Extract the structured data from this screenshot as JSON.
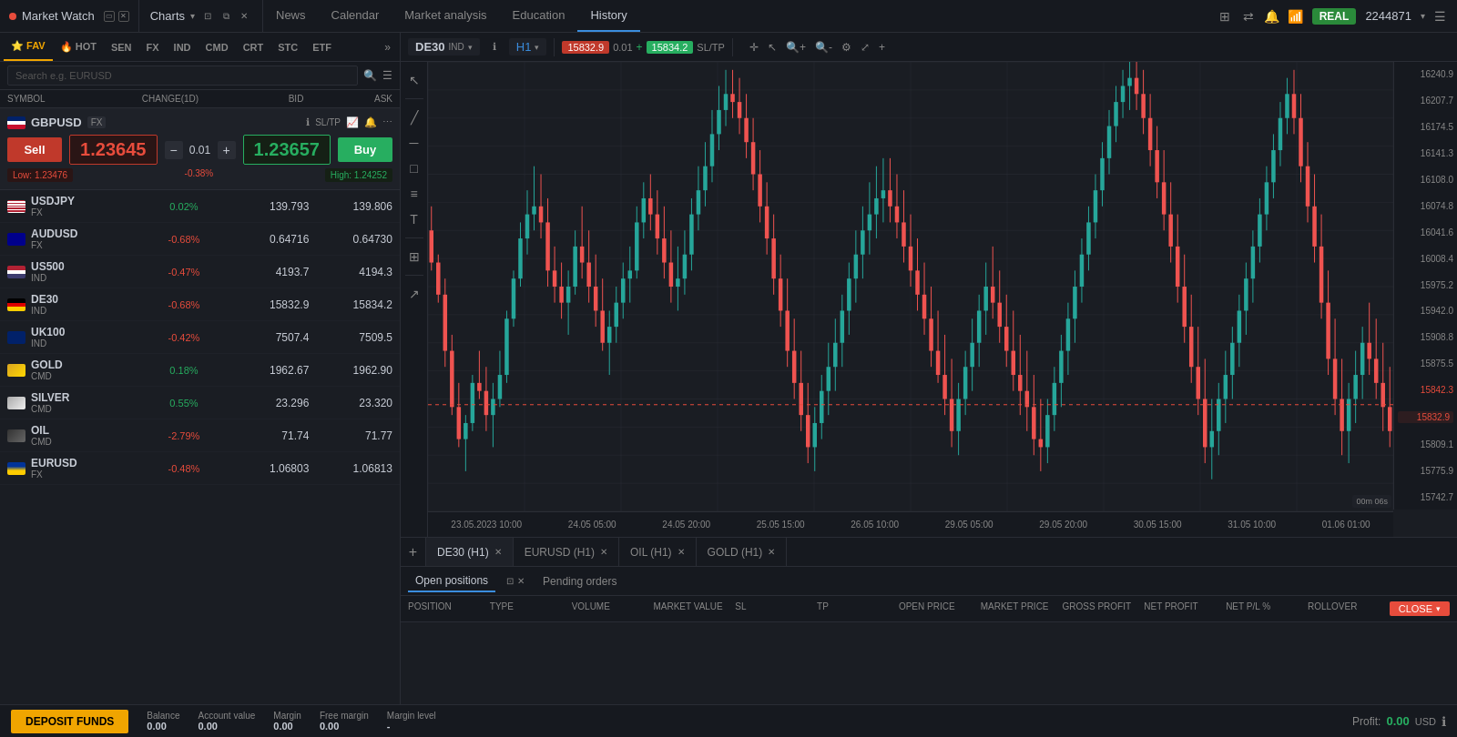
{
  "app": {
    "title": "Market Watch",
    "window_controls": [
      "minimize",
      "close"
    ]
  },
  "header": {
    "charts_label": "Charts",
    "nav_tabs": [
      {
        "label": "News",
        "active": false
      },
      {
        "label": "Calendar",
        "active": false
      },
      {
        "label": "Market analysis",
        "active": false
      },
      {
        "label": "Education",
        "active": false
      },
      {
        "label": "History",
        "active": true
      }
    ],
    "real_badge": "REAL",
    "account_number": "2244871"
  },
  "market_watch": {
    "search_placeholder": "Search e.g. EURUSD",
    "categories": [
      {
        "label": "FAV",
        "active": true
      },
      {
        "label": "HOT",
        "active": false
      },
      {
        "label": "SEN",
        "active": false
      },
      {
        "label": "FX",
        "active": false
      },
      {
        "label": "IND",
        "active": false
      },
      {
        "label": "CMD",
        "active": false
      },
      {
        "label": "CRT",
        "active": false
      },
      {
        "label": "STC",
        "active": false
      },
      {
        "label": "ETF",
        "active": false
      }
    ],
    "columns": [
      "SYMBOL",
      "CHANGE(1D)",
      "BID",
      "ASK"
    ],
    "featured": {
      "symbol": "GBPUSD",
      "type": "FX",
      "sell_label": "Sell",
      "buy_label": "Buy",
      "sell_price": "1.23645",
      "buy_price": "1.23657",
      "qty": "0.01",
      "change_pct": "-0.38%",
      "low": "Low: 1.23476",
      "high": "High: 1.24252",
      "sl_tp": "SL/TP"
    },
    "symbols": [
      {
        "symbol": "USDJPY",
        "type": "FX",
        "change": "0.02%",
        "change_pos": true,
        "bid": "139.793",
        "ask": "139.806",
        "flag": "flag-us"
      },
      {
        "symbol": "AUDUSD",
        "type": "FX",
        "change": "-0.68%",
        "change_pos": false,
        "bid": "0.64716",
        "ask": "0.64730",
        "flag": "flag-au"
      },
      {
        "symbol": "US500",
        "type": "IND",
        "change": "-0.47%",
        "change_pos": false,
        "bid": "4193.7",
        "ask": "4194.3",
        "flag": "flag-us2"
      },
      {
        "symbol": "DE30",
        "type": "IND",
        "change": "-0.68%",
        "change_pos": false,
        "bid": "15832.9",
        "ask": "15834.2",
        "flag": "flag-de"
      },
      {
        "symbol": "UK100",
        "type": "IND",
        "change": "-0.42%",
        "change_pos": false,
        "bid": "7507.4",
        "ask": "7509.5",
        "flag": "flag-uk"
      },
      {
        "symbol": "GOLD",
        "type": "CMD",
        "change": "0.18%",
        "change_pos": true,
        "bid": "1962.67",
        "ask": "1962.90",
        "flag": "flag-gold"
      },
      {
        "symbol": "SILVER",
        "type": "CMD",
        "change": "0.55%",
        "change_pos": true,
        "bid": "23.296",
        "ask": "23.320",
        "flag": "flag-silver"
      },
      {
        "symbol": "OIL",
        "type": "CMD",
        "change": "-2.79%",
        "change_pos": false,
        "bid": "71.74",
        "ask": "71.77",
        "flag": "flag-oil"
      },
      {
        "symbol": "EURUSD",
        "type": "FX",
        "change": "-0.48%",
        "change_pos": false,
        "bid": "1.06803",
        "ask": "1.06813",
        "flag": "flag-eu"
      }
    ]
  },
  "chart": {
    "symbol": "DE30",
    "type": "IND",
    "timeframe": "H1",
    "current_price_red": "15832.9",
    "spread": "0.01",
    "current_price_green": "15834.2",
    "sl_tp": "SL/TP",
    "price_labels": [
      "16240.9",
      "16207.7",
      "16174.5",
      "16141.3",
      "16108.0",
      "16074.8",
      "16041.6",
      "16008.4",
      "15975.2",
      "15942.0",
      "15908.8",
      "15875.5",
      "15842.3",
      "15832.9",
      "15809.1",
      "15775.9",
      "15742.7"
    ],
    "time_labels": [
      "23.05.2023 10:00",
      "24.05 05:00",
      "24.05 20:00",
      "25.05 15:00",
      "26.05 10:00",
      "29.05 05:00",
      "29.05 20:00",
      "30.05 15:00",
      "31.05 10:00",
      "01.06 01:00"
    ],
    "tabs": [
      {
        "label": "DE30 (H1)",
        "active": true
      },
      {
        "label": "EURUSD (H1)",
        "active": false
      },
      {
        "label": "OIL (H1)",
        "active": false
      },
      {
        "label": "GOLD (H1)",
        "active": false
      }
    ]
  },
  "positions": {
    "open_tab": "Open positions",
    "pending_tab": "Pending orders",
    "columns": [
      "POSITION",
      "TYPE",
      "VOLUME",
      "MARKET VALUE",
      "SL",
      "TP",
      "OPEN PRICE",
      "MARKET PRICE",
      "GROSS PROFIT",
      "NET PROFIT",
      "NET P/L %",
      "ROLLOVER"
    ],
    "close_all_label": "CLOSE"
  },
  "status_bar": {
    "deposit_label": "DEPOSIT FUNDS",
    "balance_label": "Balance",
    "balance_value": "0.00",
    "account_value_label": "Account value",
    "account_value": "0.00",
    "margin_label": "Margin",
    "margin_value": "0.00",
    "free_margin_label": "Free margin",
    "free_margin_value": "0.00",
    "margin_level_label": "Margin level",
    "margin_level_value": "-",
    "profit_label": "Profit:",
    "profit_value": "0.00",
    "profit_currency": "USD"
  }
}
